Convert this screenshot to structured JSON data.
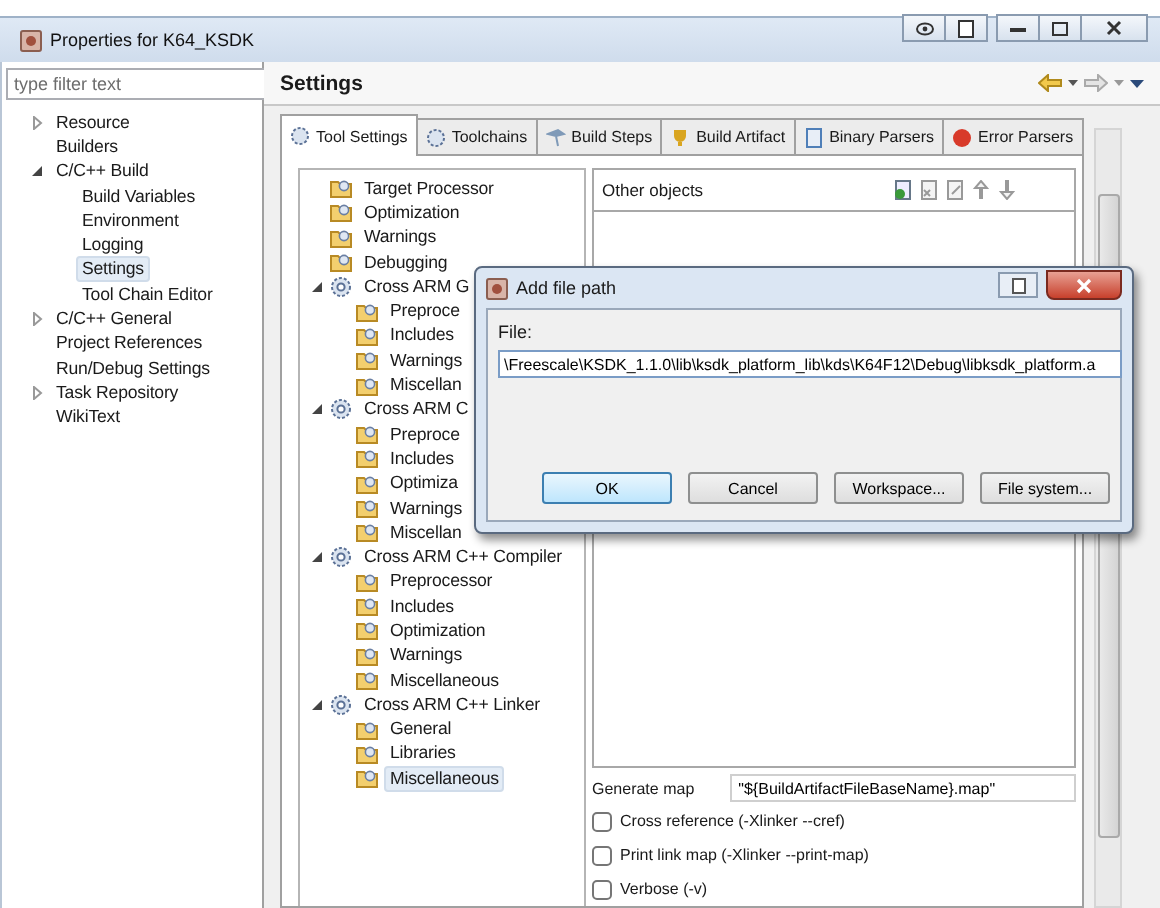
{
  "window": {
    "title": "Properties for K64_KSDK"
  },
  "filter": {
    "placeholder": "type filter text"
  },
  "nav_tree": [
    {
      "label": "Resource",
      "expanded": false,
      "selected": false
    },
    {
      "label": "Builders",
      "selected": false
    },
    {
      "label": "C/C++ Build",
      "expanded": true,
      "selected": false,
      "children": [
        {
          "label": "Build Variables",
          "selected": false
        },
        {
          "label": "Environment",
          "selected": false
        },
        {
          "label": "Logging",
          "selected": false
        },
        {
          "label": "Settings",
          "selected": true
        },
        {
          "label": "Tool Chain Editor",
          "selected": false
        }
      ]
    },
    {
      "label": "C/C++ General",
      "expanded": false,
      "selected": false
    },
    {
      "label": "Project References",
      "selected": false
    },
    {
      "label": "Run/Debug Settings",
      "selected": false
    },
    {
      "label": "Task Repository",
      "expanded": false,
      "selected": false
    },
    {
      "label": "WikiText",
      "selected": false
    }
  ],
  "page_title": "Settings",
  "tabs": [
    {
      "label": "Tool Settings",
      "selected": true
    },
    {
      "label": "Toolchains",
      "selected": false
    },
    {
      "label": "Build Steps",
      "selected": false
    },
    {
      "label": "Build Artifact",
      "selected": false
    },
    {
      "label": "Binary Parsers",
      "selected": false
    },
    {
      "label": "Error Parsers",
      "selected": false
    }
  ],
  "settings_tree": [
    {
      "label": "Target Processor",
      "selected": false
    },
    {
      "label": "Optimization",
      "selected": false
    },
    {
      "label": "Warnings",
      "selected": false
    },
    {
      "label": "Debugging",
      "selected": false
    },
    {
      "label": "Cross ARM G",
      "expanded": true,
      "selected": false,
      "children": [
        {
          "label": "Preproce",
          "selected": false
        },
        {
          "label": "Includes",
          "selected": false
        },
        {
          "label": "Warnings",
          "selected": false
        },
        {
          "label": "Miscellan",
          "selected": false
        }
      ]
    },
    {
      "label": "Cross ARM C",
      "expanded": true,
      "selected": false,
      "children": [
        {
          "label": "Preproce",
          "selected": false
        },
        {
          "label": "Includes",
          "selected": false
        },
        {
          "label": "Optimiza",
          "selected": false
        },
        {
          "label": "Warnings",
          "selected": false
        },
        {
          "label": "Miscellan",
          "selected": false
        }
      ]
    },
    {
      "label": "Cross ARM C++ Compiler",
      "expanded": true,
      "selected": false,
      "children": [
        {
          "label": "Preprocessor",
          "selected": false
        },
        {
          "label": "Includes",
          "selected": false
        },
        {
          "label": "Optimization",
          "selected": false
        },
        {
          "label": "Warnings",
          "selected": false
        },
        {
          "label": "Miscellaneous",
          "selected": false
        }
      ]
    },
    {
      "label": "Cross ARM C++ Linker",
      "expanded": true,
      "selected": false,
      "children": [
        {
          "label": "General",
          "selected": false
        },
        {
          "label": "Libraries",
          "selected": false
        },
        {
          "label": "Miscellaneous",
          "selected": true
        }
      ]
    }
  ],
  "other_objects": {
    "title": "Other objects"
  },
  "generate_map": {
    "label": "Generate map",
    "value": "\"${BuildArtifactFileBaseName}.map\""
  },
  "options": [
    {
      "label": "Cross reference (-Xlinker --cref)",
      "checked": false
    },
    {
      "label": "Print link map (-Xlinker --print-map)",
      "checked": false
    },
    {
      "label": "Verbose (-v)",
      "checked": false
    }
  ],
  "dialog": {
    "title": "Add file path",
    "field_label": "File:",
    "value": "\\Freescale\\KSDK_1.1.0\\lib\\ksdk_platform_lib\\kds\\K64F12\\Debug\\libksdk_platform.a",
    "buttons": [
      {
        "label": "OK",
        "default": true
      },
      {
        "label": "Cancel",
        "default": false
      },
      {
        "label": "Workspace...",
        "default": false
      },
      {
        "label": "File system...",
        "default": false
      }
    ]
  }
}
